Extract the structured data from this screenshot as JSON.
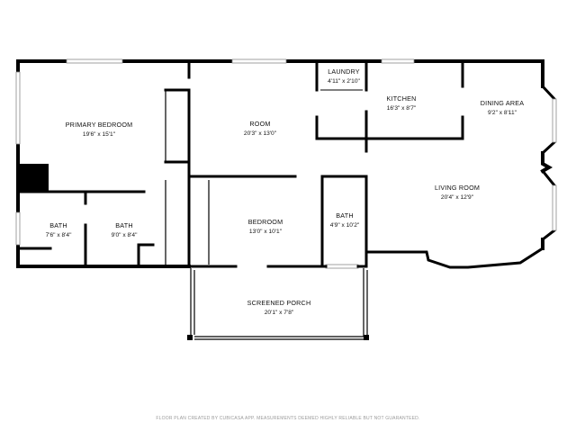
{
  "rooms": {
    "primary_bedroom": {
      "name": "PRIMARY BEDROOM",
      "dim": "19'6\" x 15'1\""
    },
    "room": {
      "name": "ROOM",
      "dim": "20'3\" x 13'0\""
    },
    "laundry": {
      "name": "LAUNDRY",
      "dim": "4'11\" x 2'10\""
    },
    "kitchen": {
      "name": "KITCHEN",
      "dim": "16'3\" x 8'7\""
    },
    "dining_area": {
      "name": "DINING AREA",
      "dim": "9'2\" x 8'11\""
    },
    "living_room": {
      "name": "LIVING ROOM",
      "dim": "20'4\" x 12'9\""
    },
    "bath_left": {
      "name": "BATH",
      "dim": "7'6\" x 8'4\""
    },
    "bath_middle": {
      "name": "BATH",
      "dim": "9'0\" x 8'4\""
    },
    "bedroom": {
      "name": "BEDROOM",
      "dim": "13'0\" x 10'1\""
    },
    "bath_right": {
      "name": "BATH",
      "dim": "4'9\" x 10'2\""
    },
    "screened_porch": {
      "name": "SCREENED PORCH",
      "dim": "20'1\" x 7'8\""
    }
  },
  "footer": {
    "disclaimer": "FLOOR PLAN CREATED BY CUBICASA APP. MEASUREMENTS DEEMED HIGHLY RELIABLE BUT NOT GUARANTEED."
  }
}
